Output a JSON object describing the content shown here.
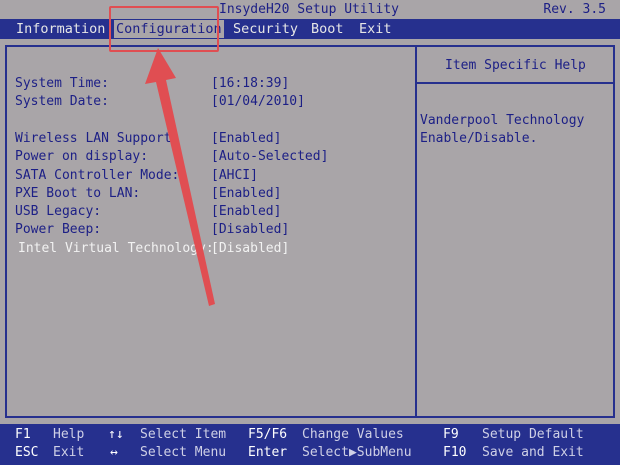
{
  "title": {
    "app": "InsydeH20 Setup Utility",
    "rev": "Rev. 3.5"
  },
  "menu": [
    {
      "label": "Information"
    },
    {
      "label": "Configuration"
    },
    {
      "label": "Security"
    },
    {
      "label": "Boot"
    },
    {
      "label": "Exit"
    }
  ],
  "help": {
    "title": "Item Specific Help",
    "line1": "Vanderpool Technology",
    "line2": "Enable/Disable."
  },
  "settings": [
    {
      "label": "System Time:",
      "value": "[16:18:39]"
    },
    {
      "label": "System Date:",
      "value": "[01/04/2010]"
    },
    {
      "label": "Wireless LAN Support:",
      "value": "[Enabled]"
    },
    {
      "label": "Power on display:",
      "value": "[Auto-Selected]"
    },
    {
      "label": "SATA Controller Mode:",
      "value": "[AHCI]"
    },
    {
      "label": "PXE Boot to LAN:",
      "value": "[Enabled]"
    },
    {
      "label": "USB Legacy:",
      "value": "[Enabled]"
    },
    {
      "label": "Power Beep:",
      "value": "[Disabled]"
    },
    {
      "label": "Intel Virtual Technology:",
      "value": "[Disabled]"
    }
  ],
  "keys": {
    "f1": "F1",
    "help": "Help",
    "esc": "ESC",
    "exit": "Exit",
    "updown": "↑↓",
    "select_item": "Select Item",
    "leftright": "↔",
    "select_menu": "Select Menu",
    "f5f6": "F5/F6",
    "change_values": "Change Values",
    "enter": "Enter",
    "select_submenu": "Select▶SubMenu",
    "f9": "F9",
    "setup_default": "Setup Default",
    "f10": "F10",
    "save_exit": "Save and Exit"
  },
  "colors": {
    "background": "#a9a5a8",
    "bar_blue": "#26308e",
    "text_blue": "#1c1f86",
    "annotation_red": "#e04e52"
  }
}
